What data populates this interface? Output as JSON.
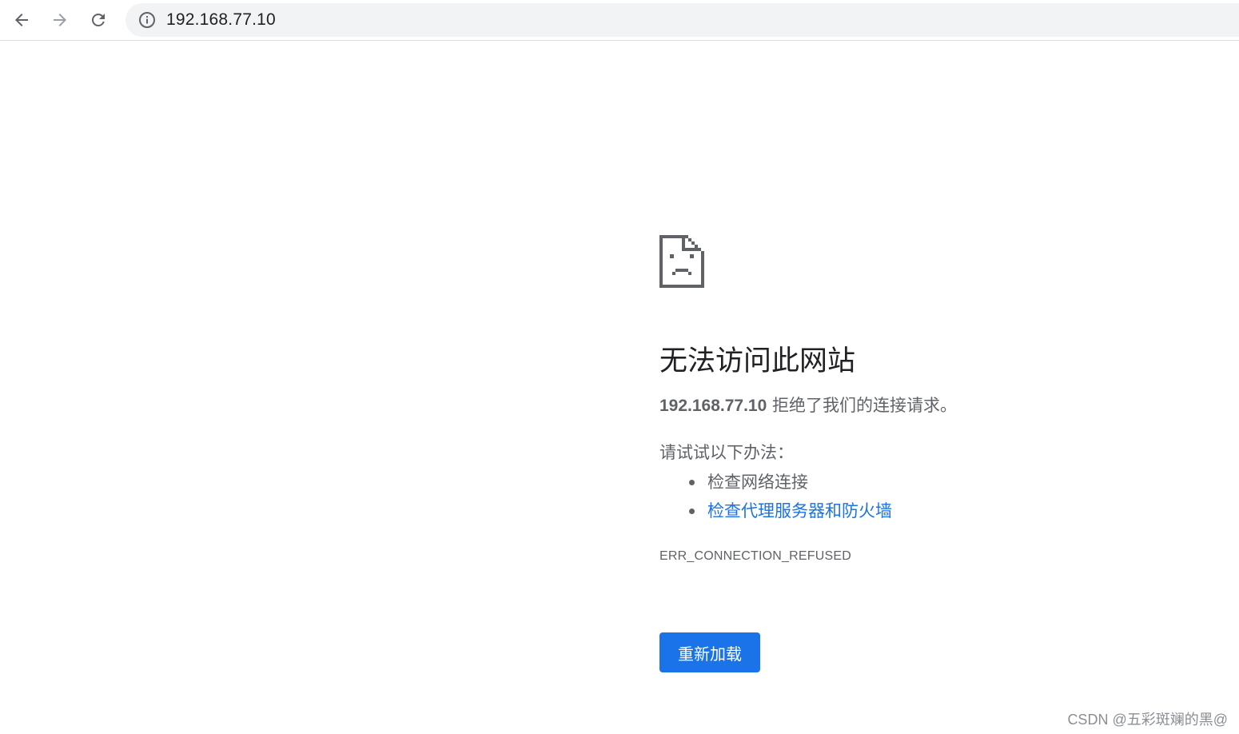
{
  "browser": {
    "url": "192.168.77.10",
    "icons": {
      "back": "arrow-left-icon",
      "forward": "arrow-right-icon",
      "reload": "reload-icon",
      "site_info": "info-icon"
    }
  },
  "error_page": {
    "icon": "sad-document-icon",
    "heading": "无法访问此网站",
    "host": "192.168.77.10",
    "message": " 拒绝了我们的连接请求。",
    "suggestions_title": "请试试以下办法：",
    "suggestions": [
      {
        "label": "检查网络连接",
        "link": false
      },
      {
        "label": "检查代理服务器和防火墙",
        "link": true
      }
    ],
    "error_code": "ERR_CONNECTION_REFUSED",
    "reload_label": "重新加载"
  },
  "watermark": "CSDN @五彩斑斓的黑@",
  "colors": {
    "accent": "#1a73e8",
    "text_secondary": "#5f6368",
    "text_primary": "#202124",
    "omnibox_bg": "#f1f3f4"
  }
}
